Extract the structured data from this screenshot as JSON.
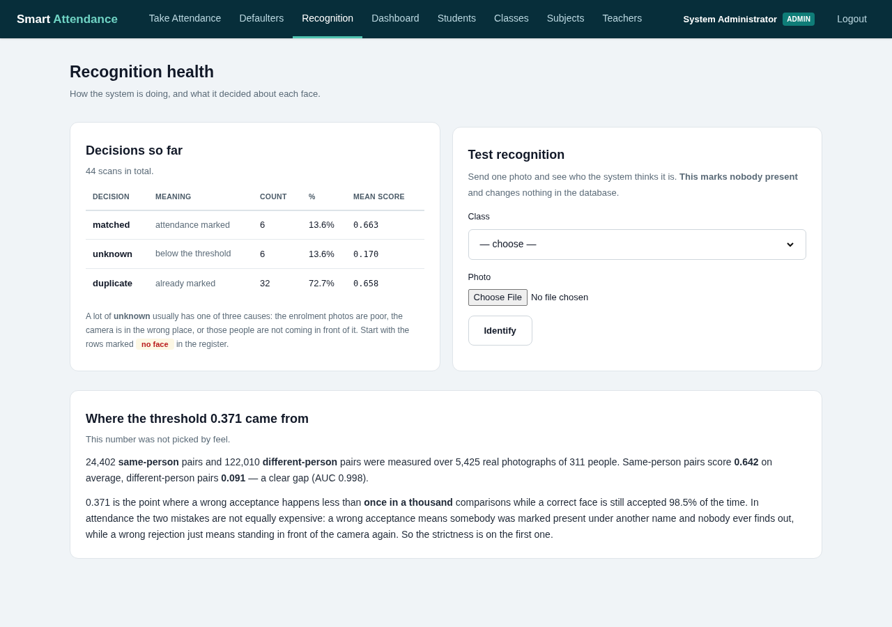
{
  "nav": {
    "brand": {
      "first": "Smart",
      "second": "Attendance"
    },
    "links": [
      {
        "label": "Take Attendance",
        "selected": false
      },
      {
        "label": "Defaulters",
        "selected": false
      },
      {
        "label": "Recognition",
        "selected": true
      },
      {
        "label": "Dashboard",
        "selected": false
      },
      {
        "label": "Students",
        "selected": false
      },
      {
        "label": "Classes",
        "selected": false
      },
      {
        "label": "Subjects",
        "selected": false
      },
      {
        "label": "Teachers",
        "selected": false
      }
    ],
    "user": "System Administrator",
    "role": "ADMIN",
    "logout": "Logout"
  },
  "page": {
    "title": "Recognition health",
    "subtitle": "How the system is doing, and what it decided about each face."
  },
  "decisions": {
    "title": "Decisions so far",
    "summary": "44 scans in total.",
    "columns": [
      "DECISION",
      "MEANING",
      "COUNT",
      "%",
      "MEAN SCORE"
    ],
    "rows": [
      [
        "matched",
        "attendance marked",
        "6",
        "13.6%",
        "0.663"
      ],
      [
        "unknown",
        "below the threshold",
        "6",
        "13.6%",
        "0.170"
      ],
      [
        "duplicate",
        "already marked",
        "32",
        "72.7%",
        "0.658"
      ]
    ],
    "note": {
      "before": "A lot of **unknown** usually has one of three causes: the enrolment photos are poor, the camera is in the wrong place, or those people are not coming in front of it. Start with the rows marked",
      "tag": "no face",
      "after": "in the register."
    }
  },
  "test": {
    "title": "Test recognition",
    "description": "Send one photo and see who the system thinks it is. **This marks nobody present** and changes nothing in the database.",
    "class_label": "Class",
    "class_value": "— choose —",
    "photo_label": "Photo",
    "file_button": "Choose File",
    "file_status": "No file chosen",
    "submit": "Identify"
  },
  "threshold": {
    "title": "Where the threshold 0.371 came from",
    "subtitle": "This number was not picked by feel.",
    "paragraphs": [
      "24,402 **same-person** pairs and 122,010 **different-person** pairs were measured over 5,425 real photographs of 311 people. Same-person pairs score **0.642** on average, different-person pairs **0.091** — a clear gap (AUC 0.998).",
      "0.371 is the point where a wrong acceptance happens less than **once in a thousand** comparisons while a correct face is still accepted 98.5% of the time. In attendance the two mistakes are not equally expensive: a wrong acceptance means somebody was marked present under another name and nobody ever finds out, while a wrong rejection just means standing in front of the camera again. So the strictness is on the first one."
    ]
  }
}
